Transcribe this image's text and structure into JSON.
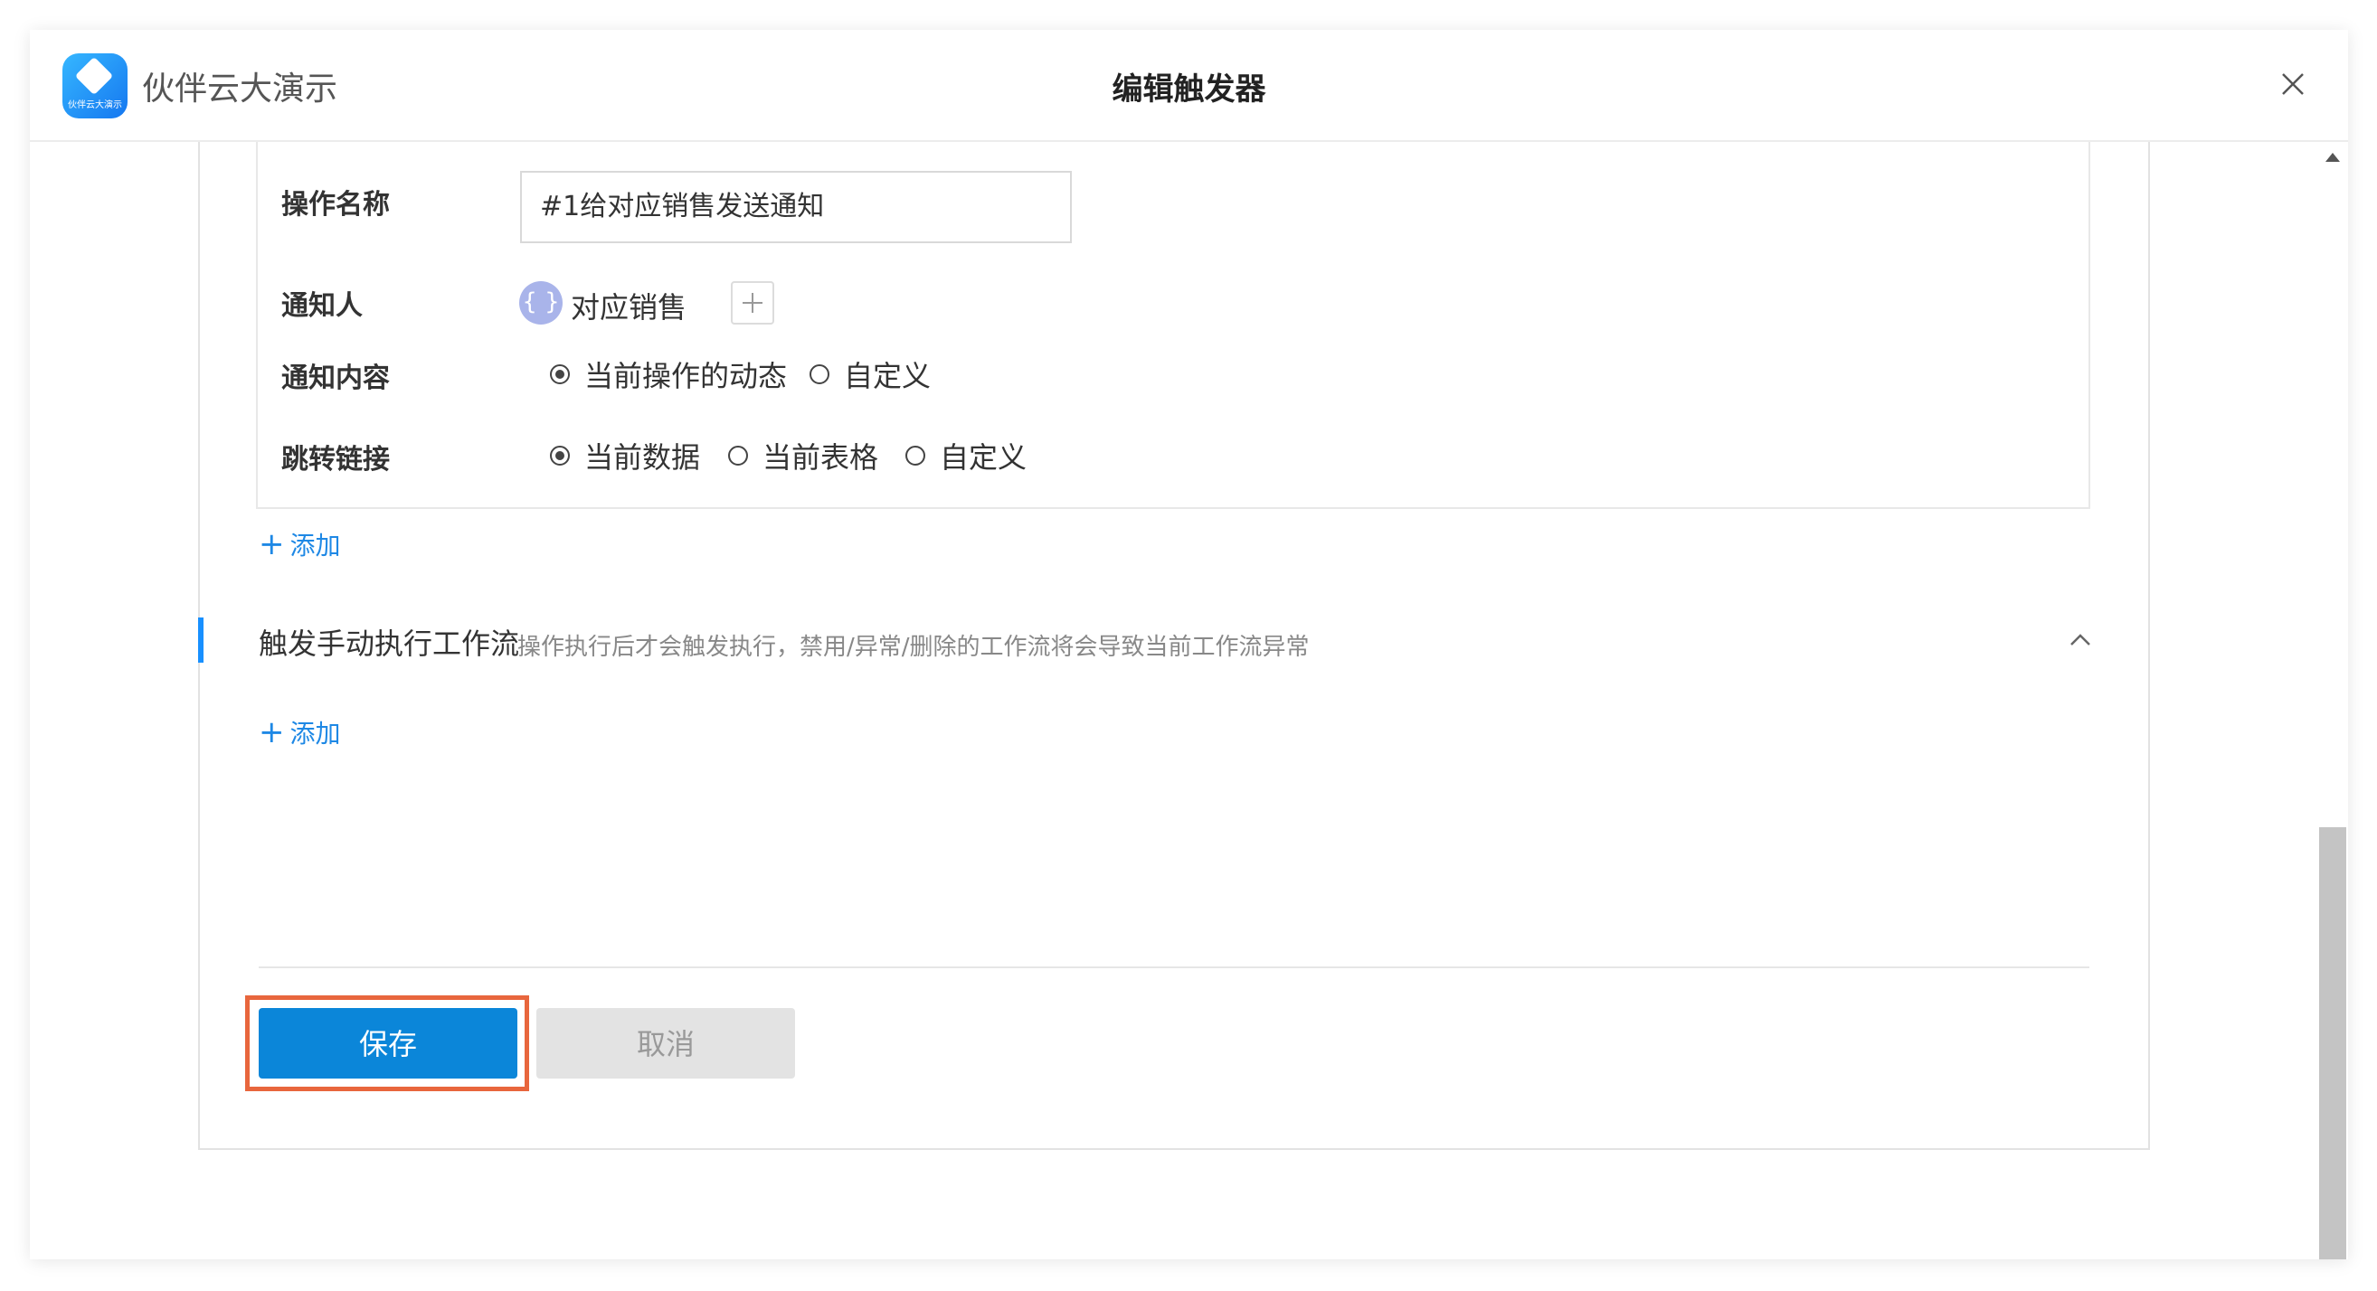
{
  "header": {
    "app_name": "伙伴云大演示",
    "logo_text": "伙伴云大演示",
    "title": "编辑触发器"
  },
  "action": {
    "name_label": "操作名称",
    "name_value": "#1给对应销售发送通知",
    "notify_label": "通知人",
    "notify_tag": "对应销售",
    "content_label": "通知内容",
    "content_options": [
      {
        "label": "当前操作的动态",
        "checked": true
      },
      {
        "label": "自定义",
        "checked": false
      }
    ],
    "link_label": "跳转链接",
    "link_options": [
      {
        "label": "当前数据",
        "checked": true
      },
      {
        "label": "当前表格",
        "checked": false
      },
      {
        "label": "自定义",
        "checked": false
      }
    ],
    "add_label": "添加"
  },
  "workflow_section": {
    "title": "触发手动执行工作流",
    "hint": "操作执行后才会触发执行，禁用/异常/删除的工作流将会导致当前工作流异常",
    "add_label": "添加"
  },
  "footer": {
    "save_label": "保存",
    "cancel_label": "取消"
  },
  "colors": {
    "accent": "#0b86d9",
    "highlight": "#e8663d",
    "section_bar": "#1890ff"
  }
}
